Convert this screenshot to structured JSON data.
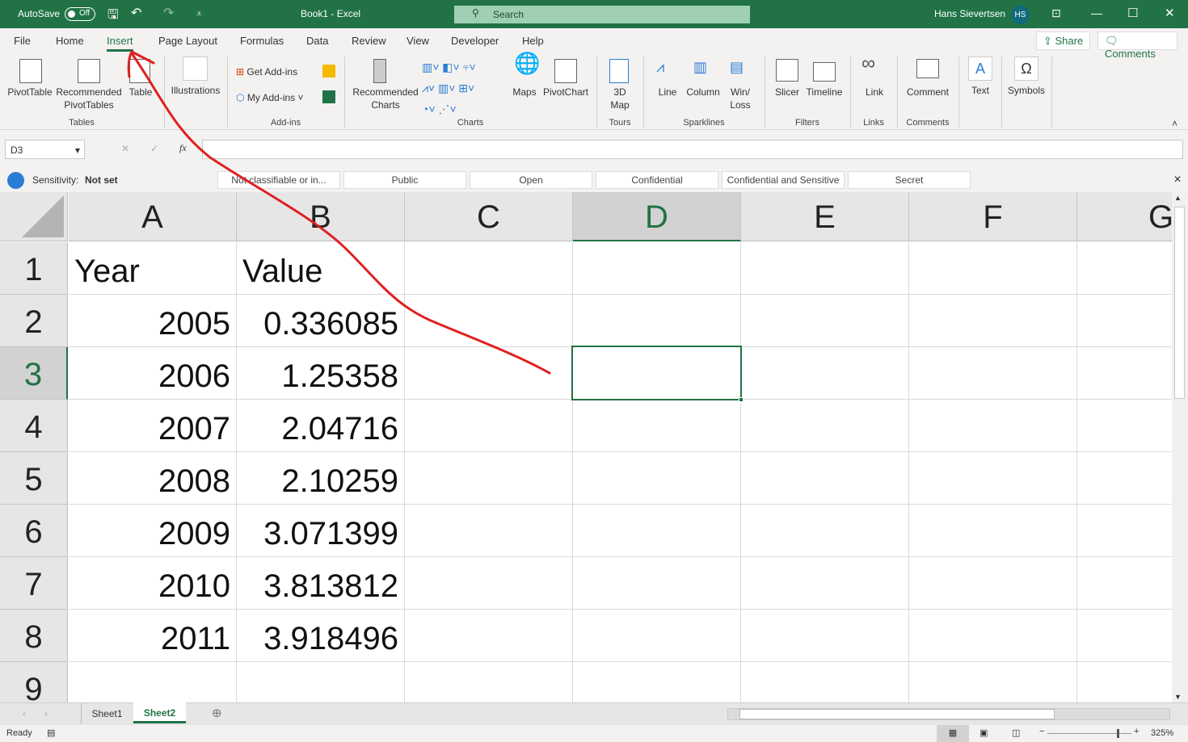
{
  "titlebar": {
    "autosave": "AutoSave",
    "autosave_state": "Off",
    "title": "Book1  -  Excel",
    "search": "Search",
    "user": "Hans Sievertsen",
    "initials": "HS"
  },
  "tabs": [
    "File",
    "Home",
    "Insert",
    "Page Layout",
    "Formulas",
    "Data",
    "Review",
    "View",
    "Developer",
    "Help"
  ],
  "active_tab": "Insert",
  "share": "Share",
  "comments_btn": "Comments",
  "ribbon": {
    "pivottable": "PivotTable",
    "rec_pivot": "Recommended PivotTables",
    "table": "Table",
    "tables_group": "Tables",
    "illustrations": "Illustrations",
    "get_addins": "Get Add-ins",
    "my_addins": "My Add-ins",
    "addins_group": "Add-ins",
    "rec_charts": "Recommended Charts",
    "maps": "Maps",
    "pivotchart": "PivotChart",
    "charts_group": "Charts",
    "map3d": "3D Map",
    "tours_group": "Tours",
    "line": "Line",
    "column": "Column",
    "winloss": "Win/ Loss",
    "sparklines_group": "Sparklines",
    "slicer": "Slicer",
    "timeline": "Timeline",
    "filters_group": "Filters",
    "link": "Link",
    "links_group": "Links",
    "comment": "Comment",
    "comments_group": "Comments",
    "text": "Text",
    "symbols": "Symbols"
  },
  "formula_bar": {
    "name_box": "D3",
    "fx": "fx",
    "formula": ""
  },
  "sensitivity": {
    "label": "Sensitivity:",
    "value": "Not set",
    "labels": [
      "Not classifiable or in...",
      "Public",
      "Open",
      "Confidential",
      "Confidential and Sensitive",
      "Secret"
    ]
  },
  "sheet": {
    "columns": [
      "A",
      "B",
      "C",
      "D",
      "E",
      "F",
      "G"
    ],
    "rows": [
      "1",
      "2",
      "3",
      "4",
      "5",
      "6",
      "7",
      "8",
      "9"
    ],
    "selected_cell": "D3",
    "cells": [
      [
        "Year",
        "Value"
      ],
      [
        "2005",
        "0.336085"
      ],
      [
        "2006",
        "1.25358"
      ],
      [
        "2007",
        "2.04716"
      ],
      [
        "2008",
        "2.10259"
      ],
      [
        "2009",
        "3.071399"
      ],
      [
        "2010",
        "3.813812"
      ],
      [
        "2011",
        "3.918496"
      ],
      [
        "",
        ""
      ]
    ]
  },
  "sheet_tabs": [
    "Sheet1",
    "Sheet2"
  ],
  "active_sheet": "Sheet2",
  "status": {
    "ready": "Ready",
    "zoom": "325%"
  },
  "colors": {
    "accent": "#217346",
    "annotation": "#e02020"
  }
}
